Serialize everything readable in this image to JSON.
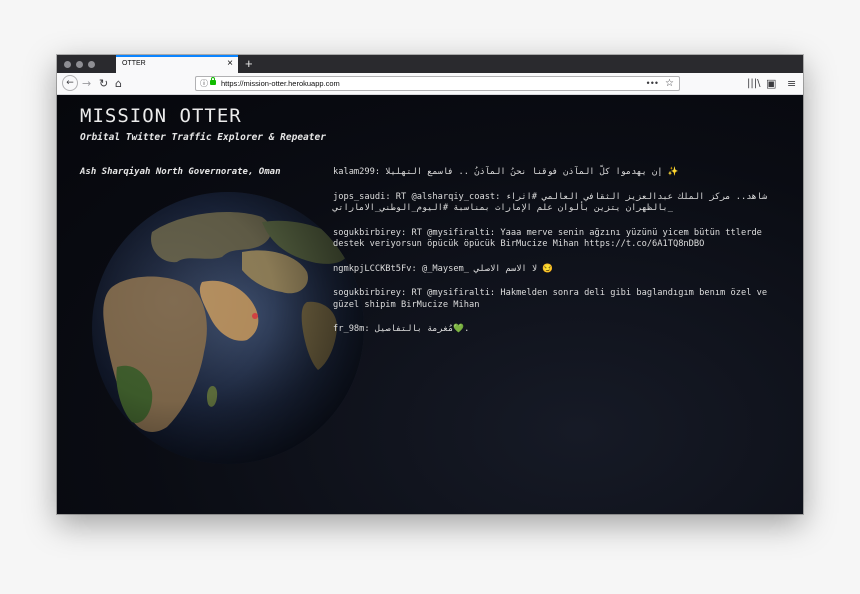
{
  "browser": {
    "tab_title": "OTTER",
    "tab_close": "×",
    "new_tab": "+",
    "url": "https://mission-otter.herokuapp.com",
    "page_actions": "•••",
    "icons": {
      "back": "arrow-left",
      "forward": "arrow-right",
      "reload": "reload",
      "home": "home",
      "info": "info",
      "lock": "lock",
      "star": "star",
      "library": "library",
      "sidebar": "sidebar",
      "menu": "hamburger-menu"
    }
  },
  "app": {
    "title": "MISSION OTTER",
    "subtitle": "Orbital Twitter Traffic Explorer & Repeater",
    "location": "Ash Sharqiyah North Governorate, Oman"
  },
  "feed": [
    {
      "user": "kalam299",
      "text": "إن يهدموا كلّ المآذن فوقنا نحنُ المآذنُ .. فاسمع التهليلا ✨"
    },
    {
      "user": "jops_saudi",
      "text": "RT @alsharqiy_coast: شاهد.. مركز الملك عبدالعزيز الثقافي العالمي #اثراء بالظهران يتزين بألوان علم الإمارات بمناسبة #اليوم_الوطني_الاماراتي_"
    },
    {
      "user": "sogukbirbirey",
      "text": "RT @mysifiralti: Yaaa merve senin ağzını yüzünü yicem bütün ttlerde destek veriyorsun öpücük öpücük BirMucize Mihan https://t.co/6A1TQ8nDBO"
    },
    {
      "user": "ngmkpjLCCKBt5Fv",
      "text": "@_Maysem_ لا الاسم الاصلي 😏"
    },
    {
      "user": "sogukbirbirey",
      "text": "RT @mysifiralti: Hakmelden sonra deli gibi baglandıgım benım özel ve güzel shipim BirMucize Mihan"
    },
    {
      "user": "fr_98m",
      "text": "مُغرمة بالتفاصيل💚."
    }
  ]
}
